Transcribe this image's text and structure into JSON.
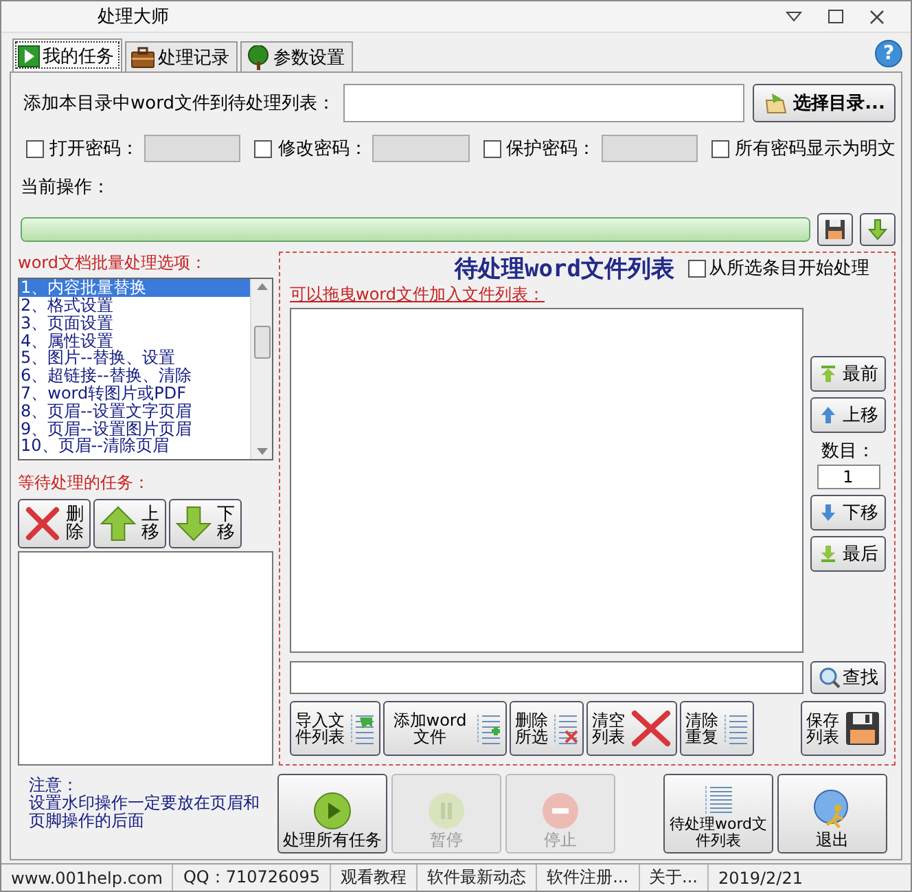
{
  "window": {
    "title": "处理大师"
  },
  "tabs": [
    {
      "label": "我的任务",
      "kind": "play",
      "selected": true
    },
    {
      "label": "处理记录",
      "kind": "case",
      "selected": false
    },
    {
      "label": "参数设置",
      "kind": "tree",
      "selected": false
    }
  ],
  "help_button": "?",
  "directory": {
    "label": "添加本目录中word文件到待处理列表：",
    "button": "选择目录..."
  },
  "passwords": [
    {
      "label": "打开密码：",
      "checked": false
    },
    {
      "label": "修改密码：",
      "checked": false
    },
    {
      "label": "保护密码：",
      "checked": false
    }
  ],
  "show_plain": {
    "label": "所有密码显示为明文",
    "checked": false
  },
  "current_operation": {
    "label": "当前操作：",
    "level": 1
  },
  "options": {
    "label": "word文档批量处理选项：",
    "items": [
      {
        "text": "1、内容批量替换",
        "selected": true
      },
      {
        "text": "2、格式设置",
        "selected": false
      },
      {
        "text": "3、页面设置",
        "selected": false
      },
      {
        "text": "4、属性设置",
        "selected": false
      },
      {
        "text": "5、图片--替换、设置",
        "selected": false
      },
      {
        "text": "6、超链接--替换、清除",
        "selected": false
      },
      {
        "text": "7、word转图片或PDF",
        "selected": false
      },
      {
        "text": "8、页眉--设置文字页眉",
        "selected": false
      },
      {
        "text": "9、页眉--设置图片页眉",
        "selected": false
      },
      {
        "text": "10、页眉--清除页眉",
        "selected": false
      }
    ]
  },
  "pending_tasks": {
    "label": "等待处理的任务：",
    "buttons": [
      {
        "label": "删除",
        "kind": "delete"
      },
      {
        "label": "上移",
        "kind": "up"
      },
      {
        "label": "下移",
        "kind": "down"
      }
    ]
  },
  "file_list": {
    "title": "待处理word文件列表",
    "from_selected": {
      "label": "从所选条目开始处理",
      "checked": false
    },
    "hint": "可以拖曳word文件加入文件列表：",
    "side_buttons": [
      {
        "label": "最前",
        "kind": "top"
      },
      {
        "label": "上移",
        "kind": "up"
      },
      {
        "label": "下移",
        "kind": "down"
      },
      {
        "label": "最后",
        "kind": "bottom"
      }
    ],
    "count": {
      "label": "数目：",
      "value": "1"
    },
    "search_button": "查找",
    "actions": [
      {
        "label": "导入文件列表",
        "kind": "import"
      },
      {
        "label": "添加word文件",
        "kind": "add"
      },
      {
        "label": "删除所选",
        "kind": "remove"
      },
      {
        "label": "清空列表",
        "kind": "clear"
      },
      {
        "label": "清除重复",
        "kind": "dedupe"
      },
      {
        "label": "保存列表",
        "kind": "save"
      }
    ]
  },
  "notes": {
    "title": "注意：",
    "text": "设置水印操作一定要放在页眉和页脚操作的后面"
  },
  "run_buttons": [
    {
      "label": "处理所有任务",
      "kind": "play",
      "disabled": false
    },
    {
      "label": "暂停",
      "kind": "pause",
      "disabled": true
    },
    {
      "label": "停止",
      "kind": "stop",
      "disabled": true
    },
    {
      "label": "待处理word文件列表",
      "kind": "list",
      "disabled": false
    },
    {
      "label": "退出",
      "kind": "exit",
      "disabled": false
    }
  ],
  "status_bar": [
    "www.001help.com",
    "QQ：710726095",
    "观看教程",
    "软件最新动态",
    "软件注册...",
    "关于...",
    "2019/2/21"
  ]
}
